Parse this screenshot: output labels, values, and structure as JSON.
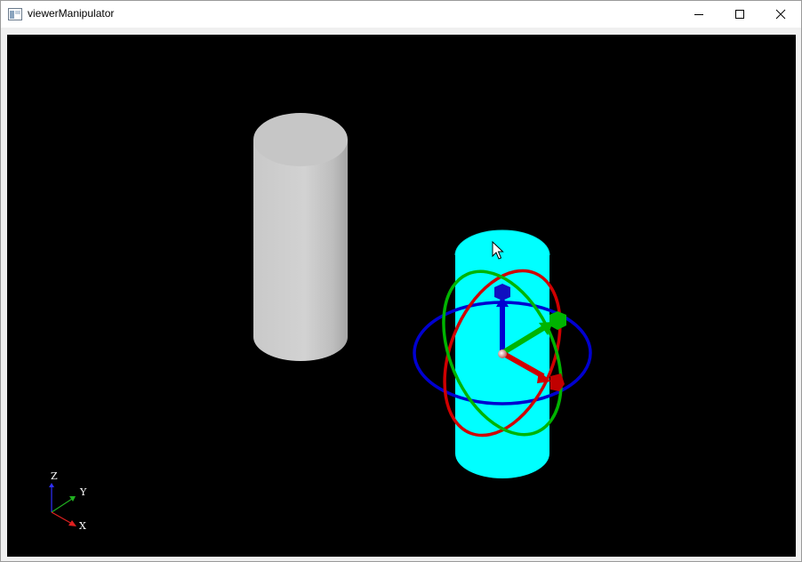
{
  "window": {
    "title": "viewerManipulator",
    "controls": {
      "minimize": "minimize",
      "maximize": "maximize",
      "close": "close"
    }
  },
  "scene": {
    "background": "#000000",
    "objects": [
      {
        "name": "gray-cylinder",
        "color": "#cfcfcf"
      },
      {
        "name": "cyan-cylinder",
        "color": "#00ffff",
        "selected": true
      }
    ],
    "manipulator": {
      "axis_colors": {
        "x": "#e00000",
        "y": "#00c000",
        "z": "#0000d0"
      }
    },
    "axis_triad": {
      "x_label": "X",
      "y_label": "Y",
      "z_label": "Z"
    }
  }
}
